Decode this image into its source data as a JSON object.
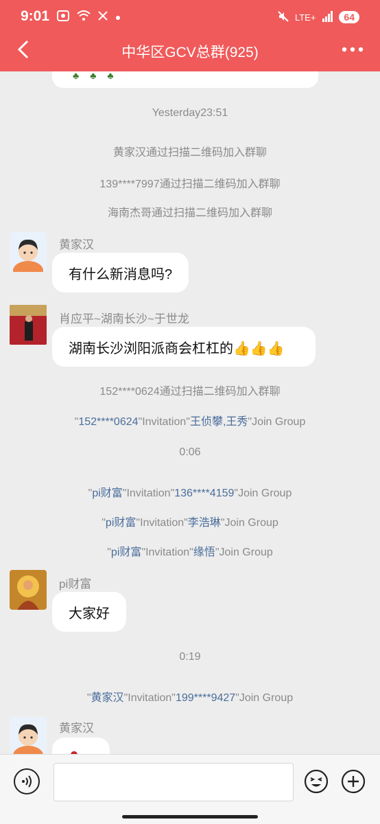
{
  "status_bar": {
    "time": "9:01",
    "network": "LTE+",
    "battery": "64"
  },
  "header": {
    "title": "中华区GCV总群(925)"
  },
  "messages": {
    "ts1": "Yesterday23:51",
    "join1": "黄家汉通过扫描二维码加入群聊",
    "join2": "139****7997通过扫描二维码加入群聊",
    "join3": "海南杰哥通过扫描二维码加入群聊",
    "m1_sender": "黄家汉",
    "m1_text": "有什么新消息吗?",
    "m2_sender": "肖应平~湖南长沙~于世龙",
    "m2_text": "湖南长沙浏阳派商会杠杠的👍👍👍",
    "join4": "152****0624通过扫描二维码加入群聊",
    "inv1": {
      "q1": "\"",
      "a": "152****0624",
      "q2": "\"Invitation\"",
      "b": "王侦攀,王秀",
      "q3": "\"Join Group"
    },
    "ts2": "0:06",
    "inv2": {
      "q1": "\"",
      "a": "pi财富",
      "q2": "\"Invitation\"",
      "b": "136****4159",
      "q3": "\"Join Group"
    },
    "inv3": {
      "q1": "\"",
      "a": "pi财富",
      "q2": "\"Invitation\"",
      "b": "李浩琳",
      "q3": "\"Join Group"
    },
    "inv4": {
      "q1": "\"",
      "a": "pi财富",
      "q2": "\"Invitation\"",
      "b": "缘悟",
      "q3": "\"Join Group"
    },
    "m3_sender": "pi财富",
    "m3_text": "大家好",
    "ts3": "0:19",
    "inv5": {
      "q1": "\"",
      "a": "黄家汉",
      "q2": "\"Invitation\"",
      "b": "199****9427",
      "q3": "\"Join Group"
    },
    "m4_sender": "黄家汉"
  },
  "colors": {
    "header": "#f05a5a",
    "background": "#ededed",
    "link": "#4a6d9b"
  }
}
